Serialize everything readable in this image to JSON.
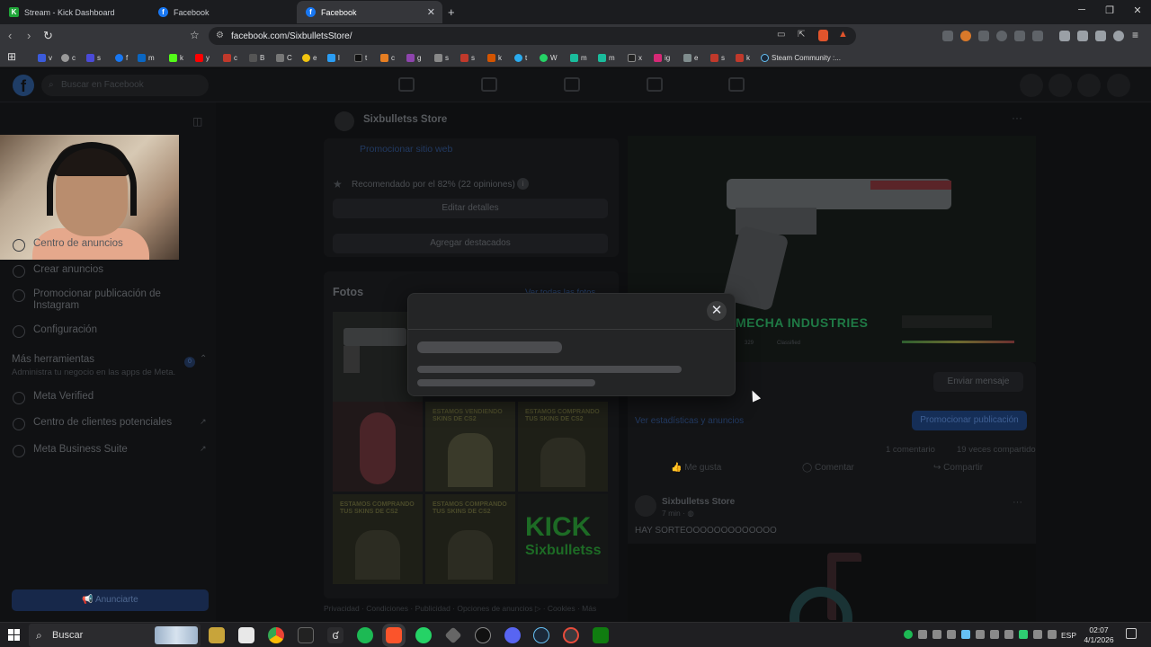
{
  "browser": {
    "tabs": [
      {
        "title": "Stream - Kick Dashboard",
        "favicon": "kick-icon",
        "active": false
      },
      {
        "title": "Facebook",
        "favicon": "facebook-icon",
        "active": false
      },
      {
        "title": "Facebook",
        "favicon": "facebook-icon",
        "active": true
      }
    ],
    "new_tab": "+",
    "url": "facebook.com/SixbulletsStore/",
    "bookmarks": [
      "v",
      "c",
      "s",
      "f",
      "m",
      "k",
      "y",
      "c",
      "B",
      "C",
      "e",
      "l",
      "t",
      "c",
      "g",
      "s",
      "s",
      "k",
      "t",
      "W",
      "m",
      "m",
      "x",
      "ig",
      "e",
      "s",
      "k",
      "Steam Community :..."
    ]
  },
  "facebook": {
    "search_placeholder": "Buscar en Facebook",
    "sidebar": {
      "items": [
        {
          "label": "Centro de anuncios"
        },
        {
          "label": "Crear anuncios"
        },
        {
          "label": "Promocionar publicación de Instagram"
        },
        {
          "label": "Configuración"
        }
      ],
      "more_tools_title": "Más herramientas",
      "more_tools_badge": "0",
      "more_tools_desc": "Administra tu negocio en las apps de Meta.",
      "tools": [
        {
          "label": "Meta Verified"
        },
        {
          "label": "Centro de clientes potenciales"
        },
        {
          "label": "Meta Business Suite"
        }
      ],
      "advertise_button": "Anunciarte"
    },
    "page": {
      "name": "Sixbulletss Store",
      "promote_site": "Promocionar sitio web",
      "recommended": "Recomendado por el 82% (22 opiniones)",
      "edit_details": "Editar detalles",
      "add_featured": "Agregar destacados",
      "photos_title": "Fotos",
      "see_all_photos": "Ver todas las fotos",
      "thumb_caption": "ESTAMOS COMPRANDO TUS SKINS DE CS2",
      "thumb_caption_alt": "ESTAMOS VENDIENDO SKINS DE CS2",
      "kick_text": "KICK",
      "kick_channel": "Sixbulletss",
      "footer": "Privacidad · Condiciones · Publicidad · Opciones de anuncios ▷ · Cookies · Más"
    },
    "pinned_post": {
      "item_title": "MECHA INDUSTRIES",
      "stat_value": "329",
      "stat_quality": "Classified",
      "stats_link": "Ver estadísticas y anuncios",
      "promote_button": "Promocionar publicación",
      "comments": "1 comentario",
      "shares": "19 veces compartido",
      "like": "Me gusta",
      "comment": "Comentar",
      "share": "Compartir",
      "edit_button": "Enviar mensaje"
    },
    "post": {
      "author": "Sixbulletss Store",
      "time": "7 min · ",
      "text": "HAY SORTEOOOOOOOOOOOOO"
    }
  },
  "taskbar": {
    "search_label": "Buscar",
    "lang": "ESP",
    "time": "02:07",
    "date": "4/1/2026"
  },
  "colors": {
    "accent_blue": "#1877f2",
    "kick_green": "#53fc18"
  }
}
